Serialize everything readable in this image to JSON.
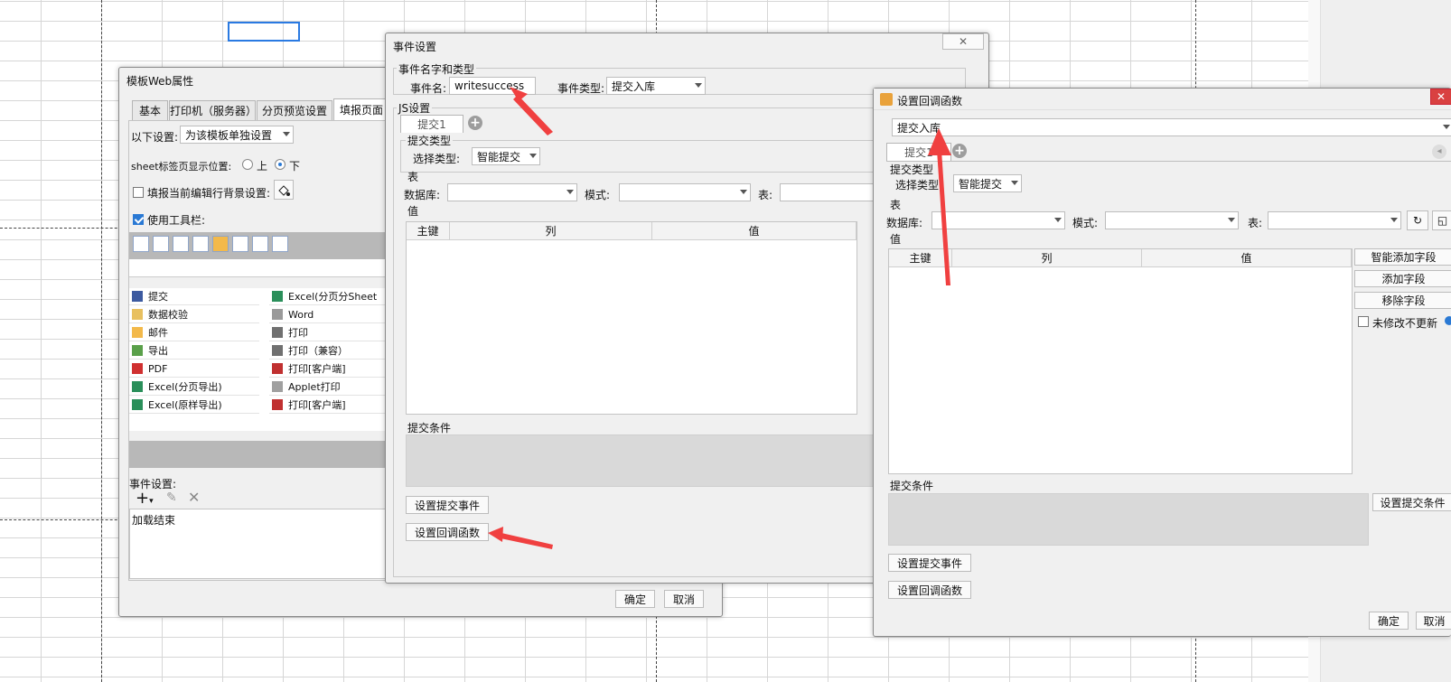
{
  "web_props": {
    "title": "模板Web属性",
    "tabs": [
      "基本",
      "打印机（服务器）",
      "分页预览设置",
      "填报页面"
    ],
    "setting_label": "以下设置:",
    "setting_value": "为该模板单独设置",
    "sheet_pos_label": "sheet标签页显示位置:",
    "radio_up": "上",
    "radio_down": "下",
    "bg_label": "填报当前编辑行背景设置:",
    "toolbar_label": "使用工具栏:",
    "list_left": [
      "提交",
      "数据校验",
      "邮件",
      "导出",
      "PDF",
      "Excel(分页导出)",
      "Excel(原样导出)"
    ],
    "list_right": [
      "Excel(分页分Sheet",
      "Word",
      "打印",
      "打印（兼容）",
      "打印[客户端]",
      "Applet打印",
      "打印[客户端]"
    ],
    "event_label": "事件设置:",
    "event_item": "加载结束",
    "ok": "确定",
    "cancel": "取消"
  },
  "event_dialog": {
    "title": "事件设置",
    "group_name": "事件名字和类型",
    "name_label": "事件名:",
    "name_value": "writesuccess",
    "type_label": "事件类型:",
    "type_value": "提交入库",
    "js_label": "JS设置",
    "tab1": "提交1",
    "submit_type_group": "提交类型",
    "select_type_label": "选择类型:",
    "select_type_value": "智能提交",
    "table_group": "表",
    "db_label": "数据库:",
    "mode_label": "模式:",
    "table_label": "表:",
    "value_group": "值",
    "cols": [
      "主键",
      "列",
      "值"
    ],
    "cond_label": "提交条件",
    "btn_submit_event": "设置提交事件",
    "btn_callback": "设置回调函数"
  },
  "callback_dialog": {
    "title": "设置回调函数",
    "top_value": "提交入库",
    "tab1": "提交1",
    "submit_type_group": "提交类型",
    "select_type_label": "选择类型:",
    "select_type_value": "智能提交",
    "table_group": "表",
    "db_label": "数据库:",
    "mode_label": "模式:",
    "table_label": "表:",
    "value_group": "值",
    "cols": [
      "主键",
      "列",
      "值"
    ],
    "side_buttons": [
      "智能添加字段",
      "添加字段",
      "移除字段"
    ],
    "no_update_label": "未修改不更新",
    "cond_label": "提交条件",
    "btn_cond": "设置提交条件",
    "btn_submit_event": "设置提交事件",
    "btn_callback": "设置回调函数",
    "ok": "确定",
    "cancel": "取消"
  },
  "colors": {
    "accent": "#2a79d4",
    "arrow": "#f04040"
  }
}
